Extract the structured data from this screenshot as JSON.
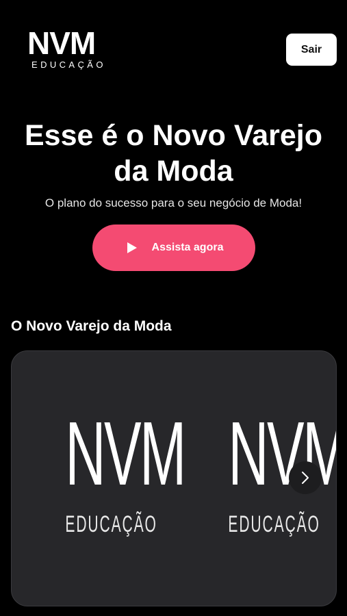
{
  "header": {
    "logo_main": "NVM",
    "logo_sub": "EDUCAÇÃO",
    "logout_label": "Sair"
  },
  "hero": {
    "title": "Esse é o Novo Varejo da Moda",
    "subtitle": "O plano do sucesso para o seu negócio de Moda!",
    "cta_label": "Assista agora",
    "cta_icon": "play-icon",
    "cta_color": "#f44b72"
  },
  "section": {
    "title": "O Novo Varejo da Moda",
    "cards": [
      {
        "logo_main": "NVM",
        "logo_sub": "EDUCAÇÃO"
      },
      {
        "logo_main": "NVM",
        "logo_sub": "EDUCAÇÃO"
      }
    ],
    "next_icon": "chevron-right-icon"
  }
}
